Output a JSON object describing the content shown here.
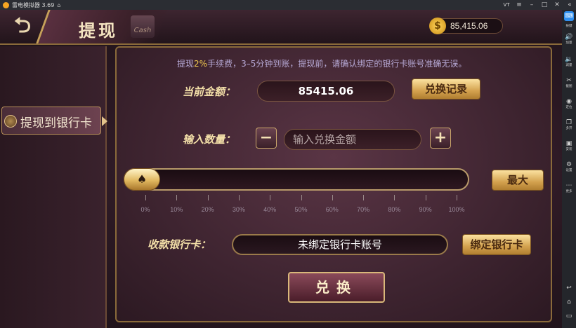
{
  "emulator": {
    "title": "雷电模拟器 3.69",
    "vt_label": "VT",
    "sidebar": [
      {
        "label": "按键",
        "icon": "keyboard-icon"
      },
      {
        "label": "加量",
        "icon": "volume-up-icon"
      },
      {
        "label": "减量",
        "icon": "volume-down-icon"
      },
      {
        "label": "截图",
        "icon": "scissors-icon"
      },
      {
        "label": "定位",
        "icon": "location-icon"
      },
      {
        "label": "多开",
        "icon": "multi-window-icon"
      },
      {
        "label": "安装",
        "icon": "install-icon"
      },
      {
        "label": "设置",
        "icon": "settings-icon"
      },
      {
        "label": "更多",
        "icon": "more-icon"
      }
    ]
  },
  "header": {
    "title": "提现",
    "cash_icon_text": "Cash",
    "balance": "85,415.06"
  },
  "left_tabs": [
    {
      "label": "提现到银行卡",
      "active": true
    }
  ],
  "form": {
    "notice_pre": "提现",
    "notice_rate": "2%",
    "notice_post": "手续费，3–5分钟到账，提现前，请确认绑定的银行卡账号准确无误。",
    "current_amount_label": "当前金额：",
    "current_amount": "85415.06",
    "history_button": "兑换记录",
    "quantity_label": "输入数量：",
    "quantity_placeholder": "输入兑换金额",
    "slider_value": 0,
    "max_button": "最大",
    "slider_ticks": [
      "0%",
      "10%",
      "20%",
      "30%",
      "40%",
      "50%",
      "60%",
      "70%",
      "80%",
      "90%",
      "100%"
    ],
    "card_label": "收款银行卡：",
    "card_value": "未绑定银行卡账号",
    "bind_button": "绑定银行卡",
    "exchange_button": "兑换"
  },
  "colors": {
    "accent_gold": "#e1b860",
    "notice_text": "#b7a9d6",
    "highlight": "#f0c850"
  }
}
